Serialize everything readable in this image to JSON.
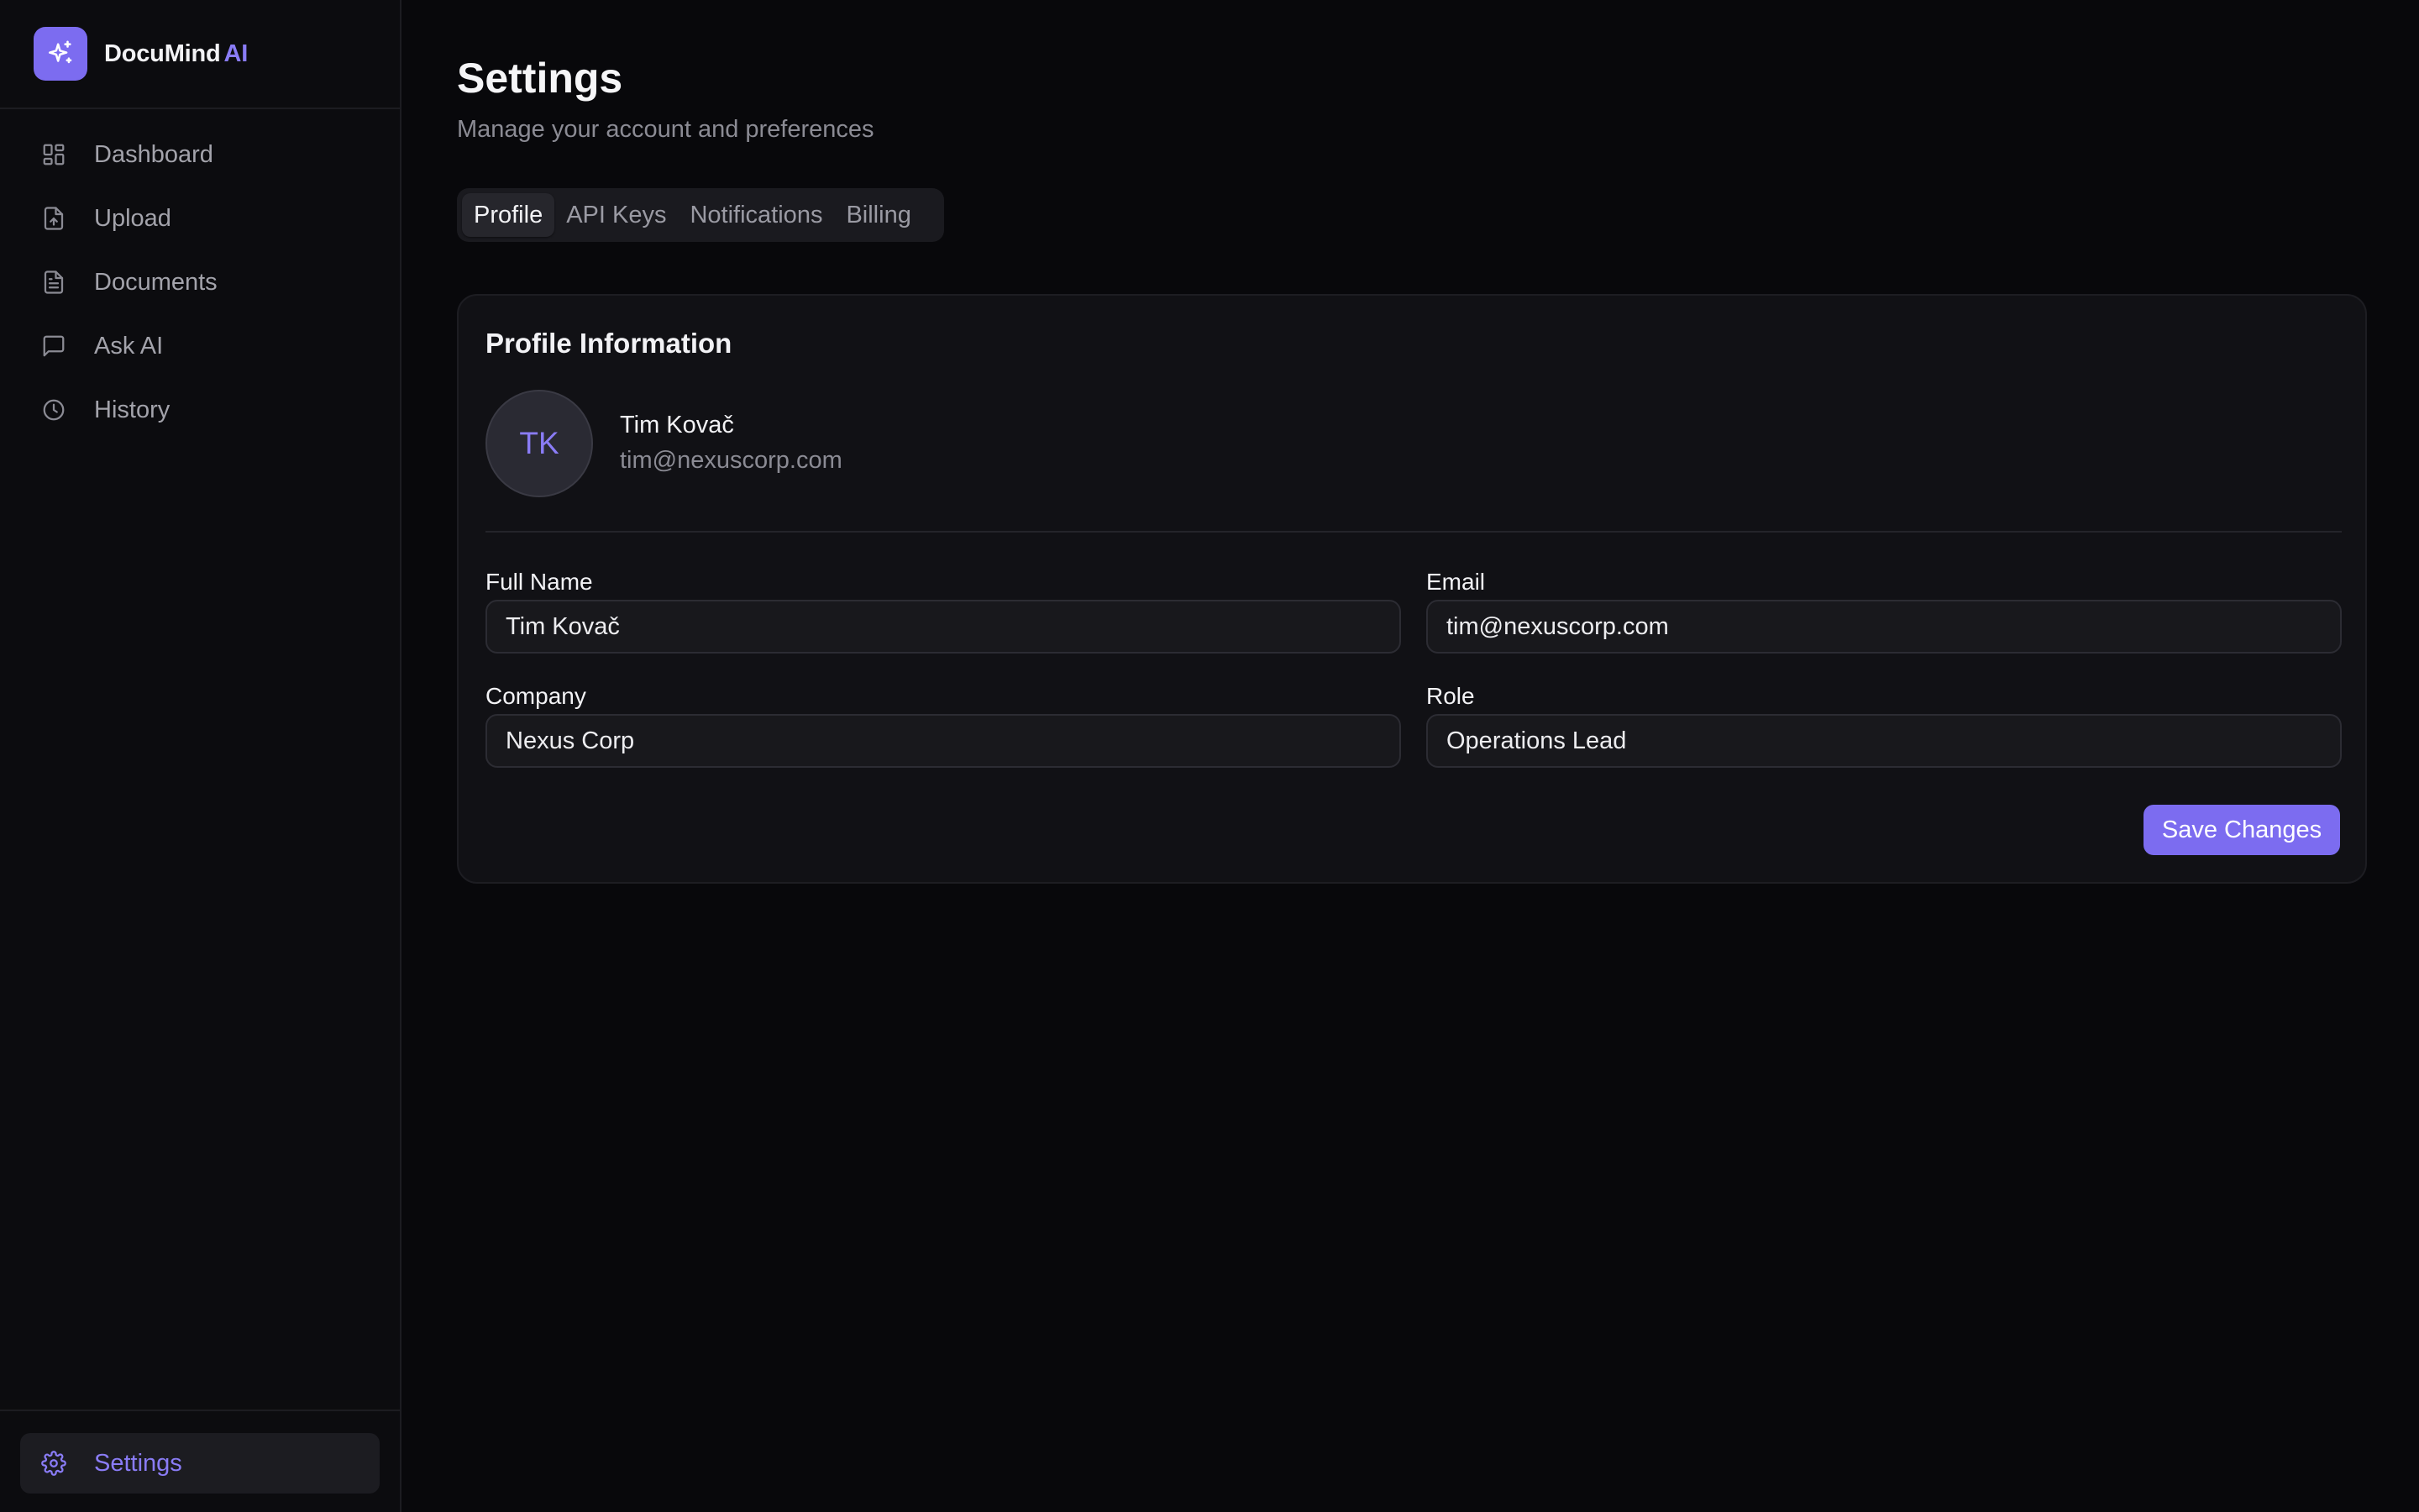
{
  "brand": {
    "name": "DocuMind",
    "accent": "AI"
  },
  "sidebar": {
    "items": [
      {
        "label": "Dashboard",
        "icon": "dashboard-icon"
      },
      {
        "label": "Upload",
        "icon": "upload-file-icon"
      },
      {
        "label": "Documents",
        "icon": "document-icon"
      },
      {
        "label": "Ask AI",
        "icon": "chat-icon"
      },
      {
        "label": "History",
        "icon": "clock-icon"
      }
    ],
    "footer": {
      "label": "Settings",
      "icon": "gear-icon"
    }
  },
  "page": {
    "title": "Settings",
    "subtitle": "Manage your account and preferences"
  },
  "tabs": [
    {
      "label": "Profile",
      "active": true
    },
    {
      "label": "API Keys",
      "active": false
    },
    {
      "label": "Notifications",
      "active": false
    },
    {
      "label": "Billing",
      "active": false
    }
  ],
  "profile": {
    "title": "Profile Information",
    "avatar_initials": "TK",
    "name": "Tim Kovač",
    "email": "tim@nexuscorp.com",
    "fields": {
      "full_name": {
        "label": "Full Name",
        "value": "Tim Kovač"
      },
      "email": {
        "label": "Email",
        "value": "tim@nexuscorp.com"
      },
      "company": {
        "label": "Company",
        "value": "Nexus Corp"
      },
      "role": {
        "label": "Role",
        "value": "Operations Lead"
      }
    },
    "save_label": "Save Changes"
  },
  "colors": {
    "accent": "#7c6cf0",
    "background": "#08080b",
    "sidebar": "#0c0c0f",
    "card": "#111115"
  }
}
